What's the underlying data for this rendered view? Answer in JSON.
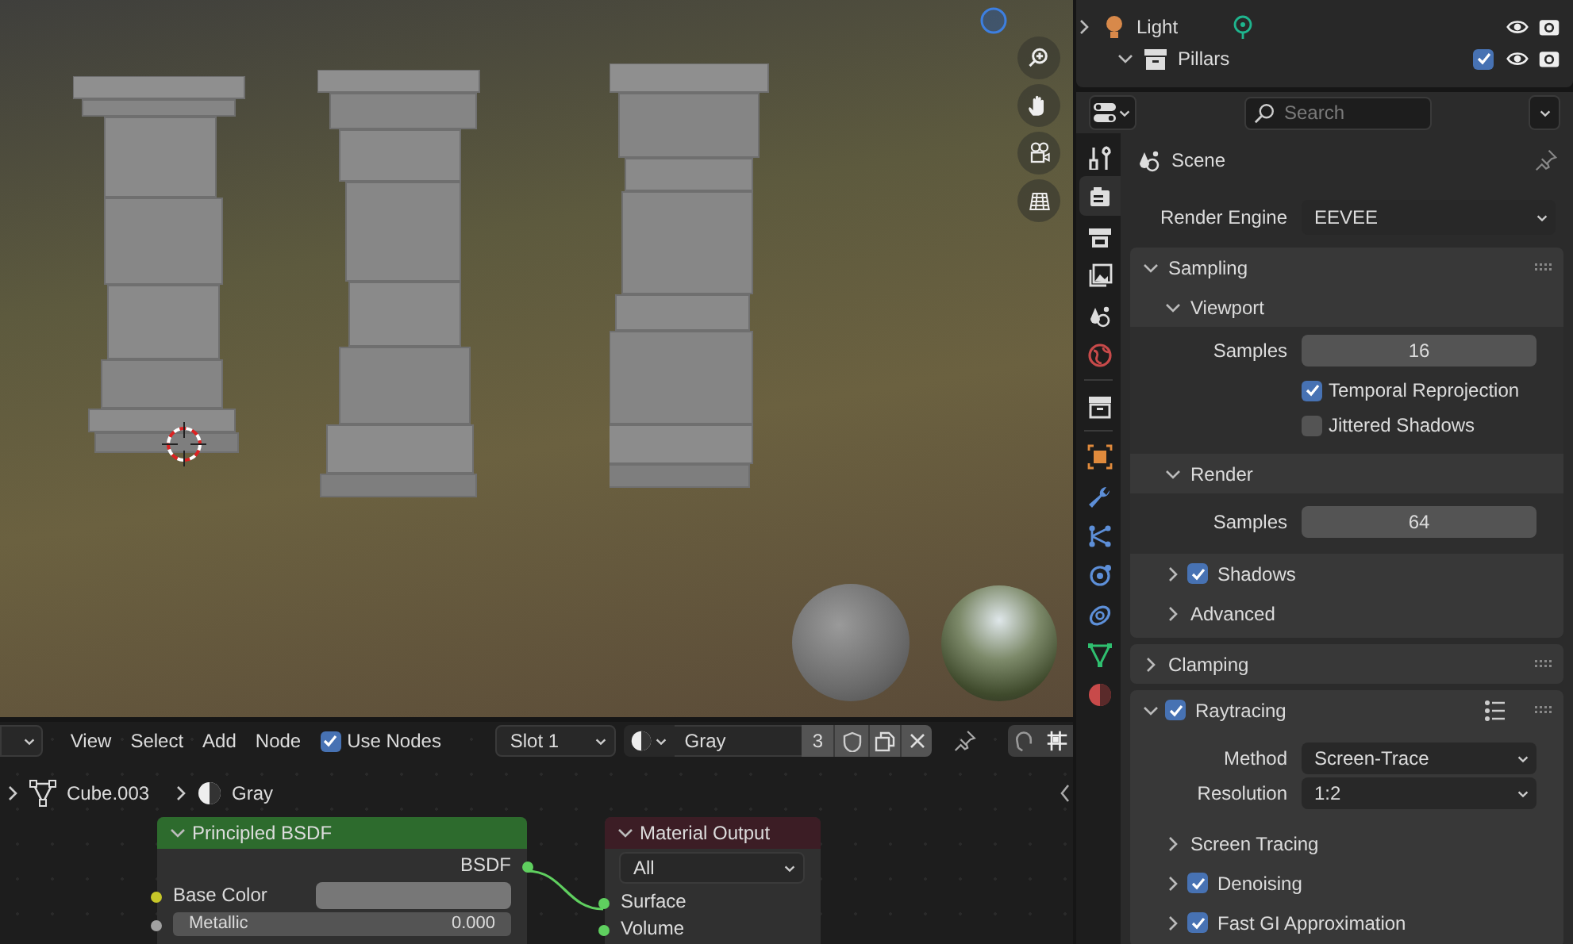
{
  "outliner": {
    "rows": [
      {
        "label": "Light",
        "kind": "light",
        "expanded": false
      },
      {
        "label": "Pillars",
        "kind": "collection",
        "expanded": true,
        "checked": true
      }
    ]
  },
  "properties": {
    "search": {
      "placeholder": "Search"
    },
    "tabs": [
      {
        "kind": "tool",
        "selected": false
      },
      {
        "kind": "render",
        "selected": true
      },
      {
        "kind": "output",
        "selected": false
      },
      {
        "kind": "view_layer",
        "selected": false
      },
      {
        "kind": "scene",
        "selected": false
      },
      {
        "kind": "world",
        "selected": false
      },
      {
        "kind": "collection",
        "selected": false
      },
      {
        "kind": "object",
        "selected": false
      },
      {
        "kind": "modifier",
        "selected": false
      },
      {
        "kind": "particles",
        "selected": false
      },
      {
        "kind": "physics",
        "selected": false
      },
      {
        "kind": "constraints",
        "selected": false
      },
      {
        "kind": "data",
        "selected": false
      },
      {
        "kind": "material",
        "selected": false
      }
    ],
    "context": "Scene",
    "render_engine": {
      "label": "Render Engine",
      "value": "EEVEE"
    },
    "panels": [
      {
        "title": "Sampling",
        "expanded": true,
        "children": [
          {
            "kind": "subpanel",
            "title": "Viewport",
            "expanded": true,
            "children": [
              {
                "kind": "number",
                "label": "Samples",
                "value": "16"
              },
              {
                "kind": "checkbox",
                "label": "Temporal Reprojection",
                "checked": true
              },
              {
                "kind": "checkbox",
                "label": "Jittered Shadows",
                "checked": false
              }
            ]
          },
          {
            "kind": "subpanel",
            "title": "Render",
            "expanded": true,
            "children": [
              {
                "kind": "number",
                "label": "Samples",
                "value": "64"
              }
            ]
          },
          {
            "kind": "subpanel",
            "title": "Shadows",
            "expanded": false,
            "checked": true
          },
          {
            "kind": "subpanel",
            "title": "Advanced",
            "expanded": false
          }
        ]
      },
      {
        "title": "Clamping",
        "expanded": false
      },
      {
        "title": "Raytracing",
        "expanded": true,
        "checked": true,
        "children": [
          {
            "kind": "dropdown",
            "label": "Method",
            "value": "Screen-Trace"
          },
          {
            "kind": "dropdown",
            "label": "Resolution",
            "value": "1:2"
          },
          {
            "kind": "subpanel",
            "title": "Screen Tracing",
            "expanded": false
          },
          {
            "kind": "subpanel",
            "title": "Denoising",
            "expanded": false,
            "checked": true
          },
          {
            "kind": "subpanel",
            "title": "Fast GI Approximation",
            "expanded": false,
            "checked": true
          }
        ]
      }
    ]
  },
  "node_editor": {
    "menus": [
      "View",
      "Select",
      "Add",
      "Node"
    ],
    "use_nodes": {
      "label": "Use Nodes",
      "checked": true
    },
    "slot": "Slot 1",
    "material": "Gray",
    "users": "3",
    "breadcrumbs": [
      {
        "kind": "mesh",
        "label": "Cube.003"
      },
      {
        "kind": "material",
        "label": "Gray"
      }
    ],
    "nodes": [
      {
        "kind": "shader",
        "title": "Principled BSDF",
        "output": "BSDF",
        "inputs": [
          {
            "kind": "color",
            "label": "Base Color"
          },
          {
            "kind": "value",
            "label": "Metallic",
            "value": "0.000",
            "level": 0
          }
        ]
      },
      {
        "kind": "output",
        "title": "Material Output",
        "target": "All",
        "inputs": [
          {
            "kind": "socket",
            "label": "Surface"
          },
          {
            "kind": "socket",
            "label": "Volume"
          }
        ]
      }
    ]
  }
}
